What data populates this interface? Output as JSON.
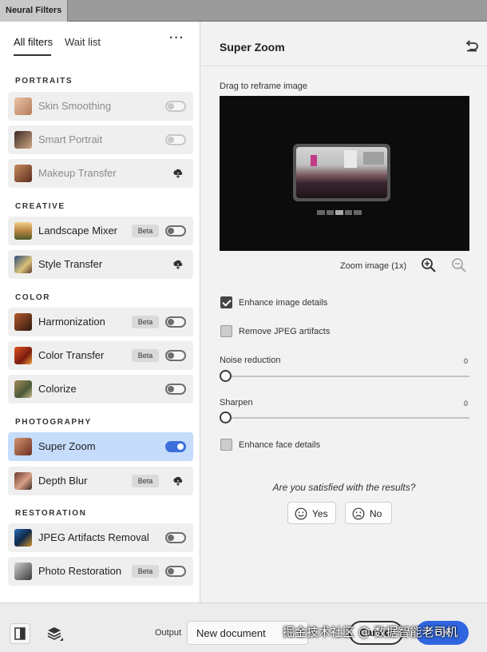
{
  "window": {
    "tab_title": "Neural Filters"
  },
  "left_panel": {
    "tabs": [
      {
        "label": "All filters"
      },
      {
        "label": "Wait list"
      }
    ],
    "more_label": "···",
    "sections": {
      "portraits": "PORTRAITS",
      "creative": "CREATIVE",
      "color": "COLOR",
      "photography": "PHOTOGRAPHY",
      "restoration": "RESTORATION"
    },
    "filters": [
      {
        "label": "Skin Smoothing",
        "state": "disabled-toggle-off"
      },
      {
        "label": "Smart Portrait",
        "state": "disabled-toggle-off"
      },
      {
        "label": "Makeup Transfer",
        "state": "download"
      },
      {
        "label": "Landscape Mixer",
        "badge": "Beta",
        "state": "toggle-off"
      },
      {
        "label": "Style Transfer",
        "state": "download"
      },
      {
        "label": "Harmonization",
        "badge": "Beta",
        "state": "toggle-off"
      },
      {
        "label": "Color Transfer",
        "badge": "Beta",
        "state": "toggle-off"
      },
      {
        "label": "Colorize",
        "state": "toggle-off"
      },
      {
        "label": "Super Zoom",
        "state": "toggle-on",
        "selected": true
      },
      {
        "label": "Depth Blur",
        "badge": "Beta",
        "state": "download"
      },
      {
        "label": "JPEG Artifacts Removal",
        "state": "toggle-off"
      },
      {
        "label": "Photo Restoration",
        "badge": "Beta",
        "state": "toggle-off"
      }
    ]
  },
  "right_panel": {
    "title": "Super Zoom",
    "drag_label": "Drag to reframe image",
    "zoom_label": "Zoom image (1x)",
    "options": [
      {
        "label": "Enhance image details",
        "checked": true
      },
      {
        "label": "Remove JPEG artifacts",
        "checked": false
      },
      {
        "label": "Enhance face details",
        "checked": false
      }
    ],
    "sliders": [
      {
        "label": "Noise reduction",
        "value": "0",
        "fraction": 0
      },
      {
        "label": "Sharpen",
        "value": "0",
        "fraction": 0
      }
    ],
    "feedback": {
      "question": "Are you satisfied with the results?",
      "yes": "Yes",
      "no": "No"
    }
  },
  "bottom_bar": {
    "output_label": "Output",
    "output_value": "New document",
    "cancel": "Cancel",
    "ok": "OK",
    "watermark": "掘金技术社区 @ 数据智能老司机"
  },
  "colors": {
    "accent": "#2f66e0",
    "selected_row": "#c5dcfb",
    "toggle_on": "#3d6fdc"
  }
}
